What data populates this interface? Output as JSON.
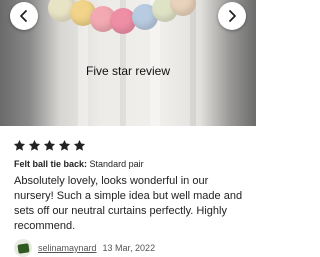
{
  "overlay": {
    "caption": "Five star review"
  },
  "colors": {
    "star": "#222222",
    "avatar_green": "#2f5a22"
  },
  "icons": {
    "prev": "chevron-left-icon",
    "next": "chevron-right-icon",
    "star": "star-icon"
  },
  "review": {
    "rating": 5,
    "variant_label": "Felt ball tie back:",
    "variant_value": "Standard pair",
    "text": "Absolutely lovely, looks wonderful in our nursery! Such a simple idea but well made and sets off our neutral curtains perfectly. Highly recommend.",
    "username": "selinamaynard",
    "date": "13 Mar, 2022"
  }
}
